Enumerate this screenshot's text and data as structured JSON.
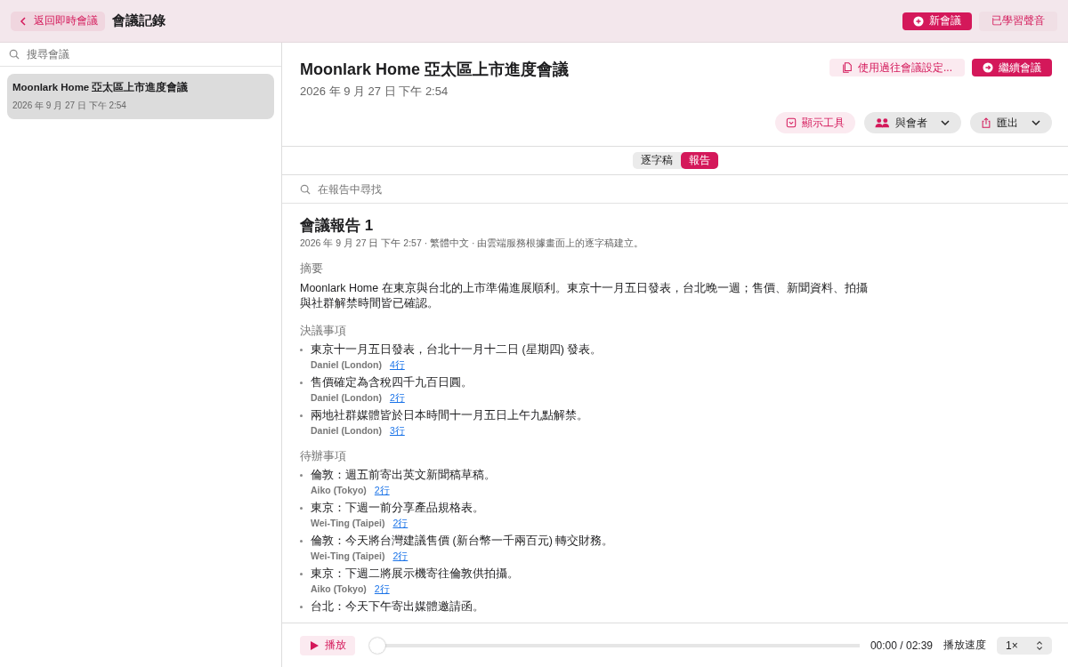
{
  "header": {
    "back_button": "返回即時會議",
    "title": "會議記錄",
    "new_button": "新會議",
    "voices_button": "已學習聲音"
  },
  "sidebar": {
    "search": {
      "placeholder": "搜尋會議"
    },
    "items": [
      {
        "title": "Moonlark Home 亞太區上市進度會議",
        "date": "2026 年 9 月 27 日 下午 2:54",
        "selected": true
      }
    ]
  },
  "meeting": {
    "title": "Moonlark Home 亞太區上市進度會議",
    "date": "2026 年 9 月 27 日 下午 2:54",
    "settings_button": "使用過往會議設定...",
    "continue_button": "繼續會議",
    "tools_button": "顯示工具",
    "participants_button": "與會者",
    "export_button": "匯出"
  },
  "tabs": [
    {
      "label": "逐字稿",
      "selected": false
    },
    {
      "label": "報告",
      "selected": true
    }
  ],
  "report_search": {
    "placeholder": "在報告中尋找"
  },
  "report": {
    "title": "會議報告 1",
    "meta": "2026 年 9 月 27 日 下午 2:57 · 繁體中文 · 由雲端服務根據畫面上的逐字稿建立。",
    "summary_heading": "摘要",
    "summary": "Moonlark Home 在東京與台北的上市準備進展順利。東京十一月五日發表，台北晚一週；售價、新聞資料、拍攝與社群解禁時間皆已確認。",
    "sections": [
      {
        "heading": "決議事項",
        "items": [
          {
            "text": "東京十一月五日發表，台北十一月十二日 (星期四) 發表。",
            "speaker": "Daniel (London)",
            "link": "4行"
          },
          {
            "text": "售價確定為含稅四千九百日圓。",
            "speaker": "Daniel (London)",
            "link": "2行"
          },
          {
            "text": "兩地社群媒體皆於日本時間十一月五日上午九點解禁。",
            "speaker": "Daniel (London)",
            "link": "3行"
          }
        ]
      },
      {
        "heading": "待辦事項",
        "items": [
          {
            "text": "倫敦：週五前寄出英文新聞稿草稿。",
            "speaker": "Aiko (Tokyo)",
            "link": "2行"
          },
          {
            "text": "東京：下週一前分享產品規格表。",
            "speaker": "Wei-Ting (Taipei)",
            "link": "2行"
          },
          {
            "text": "倫敦：今天將台灣建議售價 (新台幣一千兩百元) 轉交財務。",
            "speaker": "Wei-Ting (Taipei)",
            "link": "2行"
          },
          {
            "text": "東京：下週二將展示機寄往倫敦供拍攝。",
            "speaker": "Aiko (Tokyo)",
            "link": "2行"
          },
          {
            "text": "台北：今天下午寄出媒體邀請函。"
          }
        ]
      }
    ]
  },
  "player": {
    "play_button": "播放",
    "level": 0,
    "time": "00:00 / 02:39",
    "speed_label": "播放速度",
    "speed": "1×"
  }
}
